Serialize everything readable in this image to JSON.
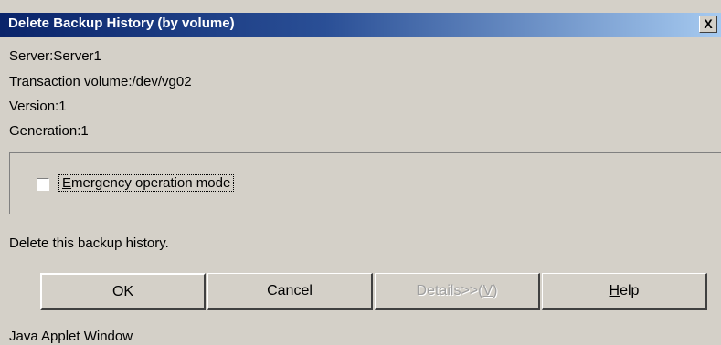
{
  "window": {
    "title": "Delete Backup History (by volume)",
    "close_label": "X"
  },
  "info": {
    "server": "Server:Server1",
    "transaction_volume": "Transaction volume:/dev/vg02",
    "version": "Version:1",
    "generation": "Generation:1"
  },
  "options": {
    "emergency_mode_label_mnemonic": "E",
    "emergency_mode_label_rest": "mergency operation mode",
    "emergency_mode_checked": false
  },
  "message": "Delete this backup history.",
  "buttons": {
    "ok": "OK",
    "cancel": "Cancel",
    "details_prefix": "Details>>(",
    "details_mnemonic": "V",
    "details_suffix": ")",
    "help_mnemonic": "H",
    "help_rest": "elp"
  },
  "footer": "Java Applet Window",
  "colors": {
    "titlebar_start": "#0a246a",
    "titlebar_end": "#a6caf0",
    "face": "#d4d0c8"
  }
}
